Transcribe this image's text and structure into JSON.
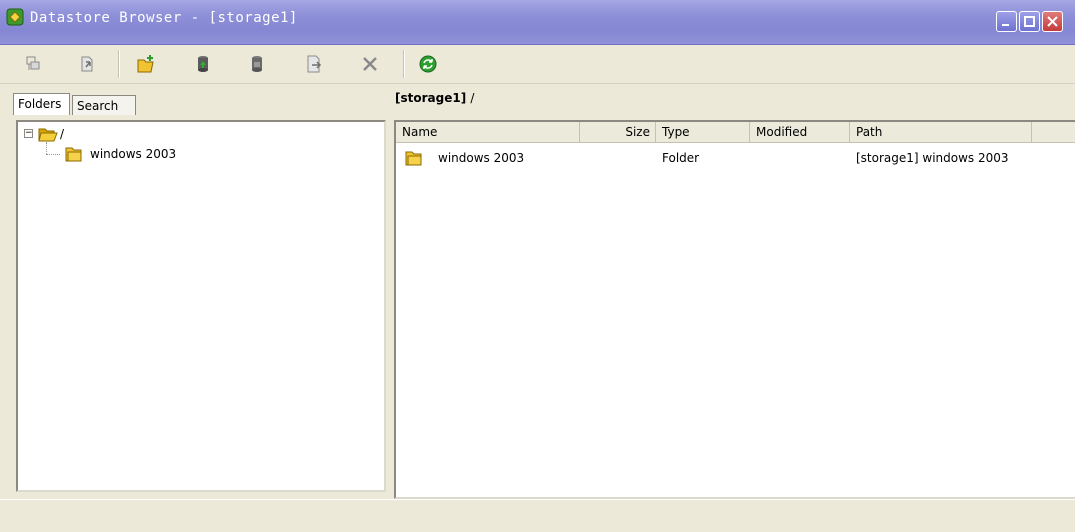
{
  "window": {
    "title": "Datastore Browser - [storage1]",
    "accent": "#8d8fd8"
  },
  "toolbar": {
    "buttons": [
      {
        "name": "browse-datastore-icon"
      },
      {
        "name": "browse-up-icon"
      },
      {
        "name": "new-folder-icon"
      },
      {
        "name": "upload-icon"
      },
      {
        "name": "download-icon"
      },
      {
        "name": "move-icon"
      },
      {
        "name": "delete-icon"
      },
      {
        "name": "refresh-icon"
      }
    ]
  },
  "tabs": {
    "folders": "Folders",
    "search": "Search"
  },
  "tree": {
    "root_label": "/",
    "expander": "−",
    "children": [
      {
        "label": "windows 2003"
      }
    ]
  },
  "location": {
    "datastore": "[storage1]",
    "path": "/"
  },
  "list": {
    "columns": [
      "Name",
      "Size",
      "Type",
      "Modified",
      "Path"
    ],
    "rows": [
      {
        "name": "windows 2003",
        "size": "",
        "type": "Folder",
        "modified": "",
        "path": "[storage1] windows 2003"
      }
    ]
  }
}
